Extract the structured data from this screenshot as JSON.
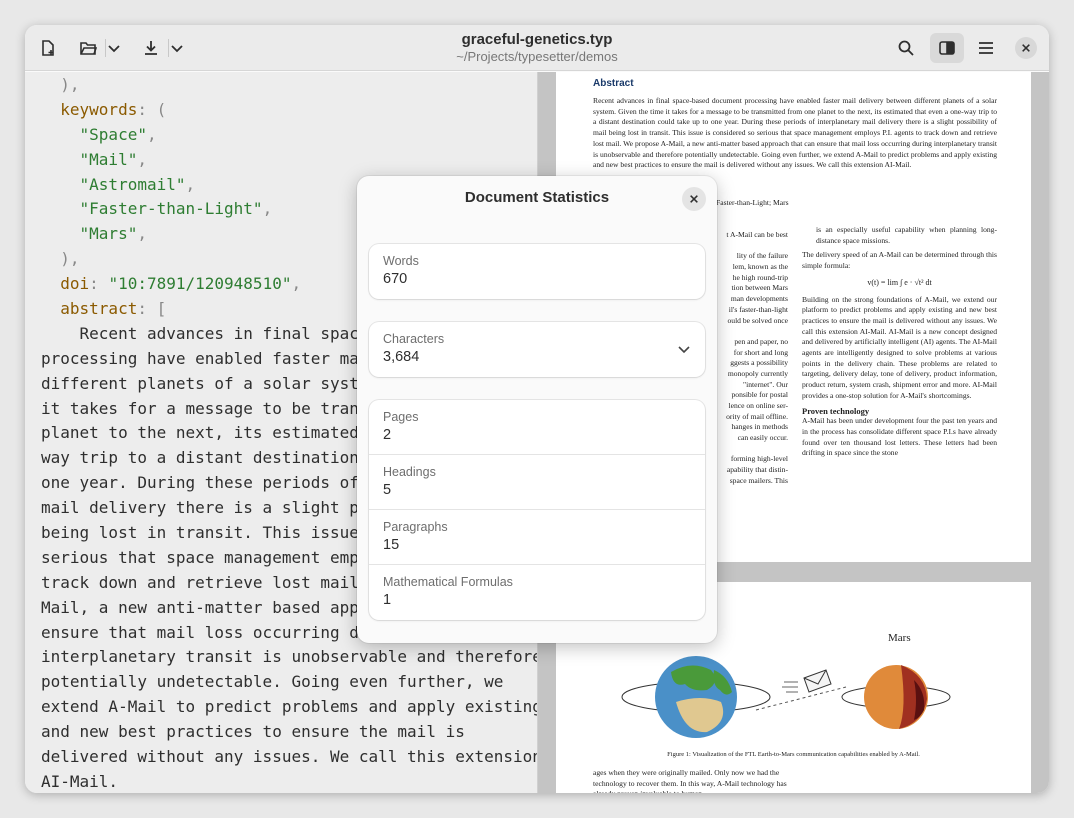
{
  "window": {
    "title": "graceful-genetics.typ",
    "subtitle": "~/Projects/typesetter/demos"
  },
  "toolbar": {
    "new_doc_icon": "new-document-icon",
    "open_icon": "folder-open-icon",
    "export_icon": "download-icon",
    "search_icon": "search-icon",
    "split_icon": "sidebar-toggle-icon",
    "menu_icon": "hamburger-menu-icon",
    "close_icon": "close-icon"
  },
  "editor": {
    "lines": [
      {
        "pre": "  ",
        "a": "),",
        "ac": "punc"
      },
      {
        "pre": "  ",
        "a": "keywords",
        "ac": "kw",
        "b": ": (",
        "bc": "punc"
      },
      {
        "pre": "    ",
        "a": "\"Space\"",
        "ac": "str",
        "b": ",",
        "bc": "punc"
      },
      {
        "pre": "    ",
        "a": "\"Mail\"",
        "ac": "str",
        "b": ",",
        "bc": "punc"
      },
      {
        "pre": "    ",
        "a": "\"Astromail\"",
        "ac": "str",
        "b": ",",
        "bc": "punc"
      },
      {
        "pre": "    ",
        "a": "\"Faster-than-Light\"",
        "ac": "str",
        "b": ",",
        "bc": "punc"
      },
      {
        "pre": "    ",
        "a": "\"Mars\"",
        "ac": "str",
        "b": ",",
        "bc": "punc"
      },
      {
        "pre": "  ",
        "a": "),",
        "ac": "punc"
      },
      {
        "pre": "  ",
        "a": "doi",
        "ac": "kw",
        "b": ": ",
        "bc": "punc",
        "c": "\"10:7891/120948510\"",
        "cc": "str",
        "d": ",",
        "dc": "punc"
      },
      {
        "pre": "  ",
        "a": "abstract",
        "ac": "kw",
        "b": ": [",
        "bc": "punc"
      },
      {
        "pre": "    ",
        "a": "Recent advances in final space-",
        "ac": ""
      },
      {
        "pre": "",
        "a": "processing have enabled faster mail",
        "ac": ""
      },
      {
        "pre": "",
        "a": "different planets of a solar system",
        "ac": ""
      },
      {
        "pre": "",
        "a": "it takes for a message to be transm",
        "ac": ""
      },
      {
        "pre": "",
        "a": "planet to the next, its estimated t",
        "ac": ""
      },
      {
        "pre": "",
        "a": "way trip to a distant destination c",
        "ac": ""
      },
      {
        "pre": "",
        "a": "one year. During these periods of i",
        "ac": ""
      },
      {
        "pre": "",
        "a": "mail delivery there is a slight pos",
        "ac": ""
      },
      {
        "pre": "",
        "a": "being lost in transit. This issue i",
        "ac": ""
      },
      {
        "pre": "",
        "a": "serious that space management emplo",
        "ac": ""
      },
      {
        "pre": "",
        "a": "track down and retrieve lost mail.",
        "ac": ""
      },
      {
        "pre": "",
        "a": "Mail, a new anti-matter based appro",
        "ac": ""
      },
      {
        "pre": "",
        "a": "ensure that mail loss occurring dur",
        "ac": ""
      },
      {
        "pre": "",
        "a": "interplanetary transit is unobservable and therefore",
        "ac": ""
      },
      {
        "pre": "",
        "a": "potentially undetectable. Going even further, we",
        "ac": ""
      },
      {
        "pre": "",
        "a": "extend A-Mail to predict problems and apply existing",
        "ac": ""
      },
      {
        "pre": "",
        "a": "and new best practices to ensure the mail is",
        "ac": ""
      },
      {
        "pre": "",
        "a": "delivered without any issues. We call this extension",
        "ac": ""
      },
      {
        "pre": "",
        "a": "AI-Mail.",
        "ac": ""
      }
    ]
  },
  "preview": {
    "abstract_heading": "Abstract",
    "abstract_text": "Recent advances in final space-based document processing have enabled faster mail delivery between different planets of a solar system. Given the time it takes for a message to be transmitted from one planet to the next, its estimated that even a one-way trip to a distant destination could take up to one year. During these periods of interplanetary mail delivery there is a slight possibility of mail being lost in transit. This issue is considered so serious that space management employs P.I. agents to track down and retrieve lost mail. We propose A-Mail, a new anti-matter based approach that can ensure that mail loss occurring during interplanetary transit is unobservable and therefore potentially undetectable. Going even further, we extend A-Mail to predict problems and apply existing and new best practices to ensure the mail is delivered without any issues. We call this extension AI-Mail.",
    "keywords_line": "Faster-than-Light; Mars",
    "left_fragments": [
      "t A-Mail can be best",
      "",
      "lity of the failure",
      "lem, known as the",
      "he high round-trip",
      "tion between Mars",
      "man developments",
      "il's faster-than-light",
      "ould be solved once",
      "",
      "pen and paper, no",
      "for short and long",
      "ggests a possibility",
      "monopoly currently",
      "\"internet\". Our",
      "ponsible for postal",
      "lence on online ser-",
      "ority of mail offline.",
      "hanges in methods",
      "can easily occur.",
      "",
      "forming high-level",
      "apability that distin-",
      "space mailers. This"
    ],
    "right_col_1": "is an especially useful capability when planning long-distance space missions.",
    "right_col_2": "The delivery speed of an A-Mail can be determined through this simple formula:",
    "formula": "v(t) = lim ∫ e · √t² dt",
    "right_col_3": "Building on the strong foundations of A-Mail, we extend our platform to predict problems and apply existing and new best practices to ensure the mail is delivered without any issues. We call this extension AI-Mail. AI-Mail is a new concept designed and delivered by artificially intelligent (AI) agents. The AI-Mail agents are intelligently designed to solve problems at various points in the delivery chain. These problems are related to targeting, delivery delay, tone of delivery, product information, product return, system crash, shipment error and more. AI-Mail provides a one-stop solution for A-Mail's shortcomings.",
    "section_heading": "Proven technology",
    "right_col_4": "A-Mail has been under development four the past ten years and in the process has consolidate different space P.I.s have already found over ten thousand lost letters. These letters had been drifting in space since the stone",
    "figure_label_mars": "Mars",
    "figure_caption": "Figure 1:  Visualization of the FTL Earth-to-Mars communication capabilities enabled by A-Mail.",
    "page2_text": "ages when they were originally mailed. Only now we had the technology to recover them. In this way, A-Mail technology has already proven invaluable to human"
  },
  "dialog": {
    "title": "Document Statistics",
    "words_label": "Words",
    "words_value": "670",
    "characters_label": "Characters",
    "characters_value": "3,684",
    "rows": [
      {
        "label": "Pages",
        "value": "2"
      },
      {
        "label": "Headings",
        "value": "5"
      },
      {
        "label": "Paragraphs",
        "value": "15"
      },
      {
        "label": "Mathematical Formulas",
        "value": "1"
      }
    ]
  },
  "colors": {
    "accent_heading": "#1a3a6a",
    "code_keyword": "#8b5a00",
    "code_string": "#2e7d32"
  }
}
